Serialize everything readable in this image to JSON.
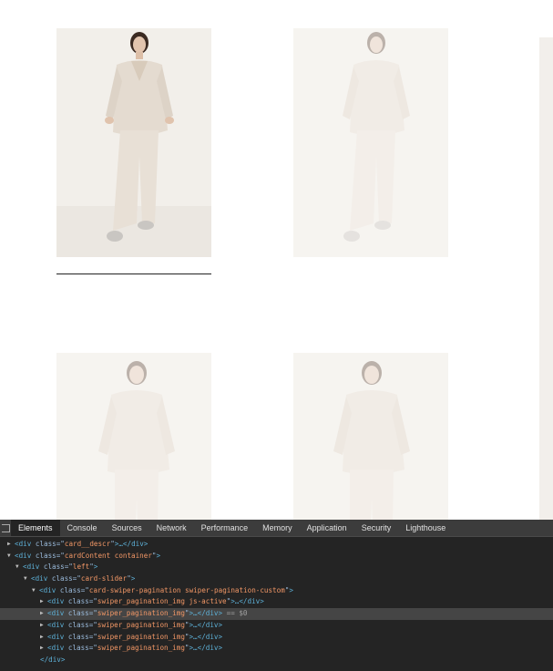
{
  "page": {
    "thumbnails": [
      {
        "name": "thumbnail-1",
        "state": "active"
      },
      {
        "name": "thumbnail-2",
        "state": "faded"
      },
      {
        "name": "thumbnail-3",
        "state": "faded"
      },
      {
        "name": "thumbnail-4",
        "state": "faded"
      }
    ]
  },
  "devtools": {
    "tabs": [
      "Elements",
      "Console",
      "Sources",
      "Network",
      "Performance",
      "Memory",
      "Application",
      "Security",
      "Lighthouse"
    ],
    "active_tab": "Elements",
    "rows": [
      {
        "tag": "div",
        "attr": "class",
        "val": "card__descr",
        "tail": ">…</",
        "close": "div",
        "selected": false
      },
      {
        "tag": "div",
        "attr": "class",
        "val": "cardContent container",
        "tail": ">",
        "selected": false
      },
      {
        "tag": "div",
        "attr": "class",
        "val": "left",
        "tail": ">",
        "selected": false
      },
      {
        "tag": "div",
        "attr": "class",
        "val": "card-slider",
        "tail": ">",
        "selected": false
      },
      {
        "tag": "div",
        "attr": "class",
        "val": "card-swiper-pagination swiper-pagination-custom",
        "tail": ">",
        "selected": false
      },
      {
        "tag": "div",
        "attr": "class",
        "val": "swiper_pagination_img js-active",
        "tail": ">…</",
        "close": "div",
        "selected": false
      },
      {
        "tag": "div",
        "attr": "class",
        "val": "swiper_pagination_img",
        "tail": ">…</",
        "close": "div",
        "ref": " == $0",
        "selected": true
      },
      {
        "tag": "div",
        "attr": "class",
        "val": "swiper_pagination_img",
        "tail": ">…</",
        "close": "div",
        "selected": false
      },
      {
        "tag": "div",
        "attr": "class",
        "val": "swiper_pagination_img",
        "tail": ">…</",
        "close": "div",
        "selected": false
      },
      {
        "tag": "div",
        "attr": "class",
        "val": "swiper_pagination_img",
        "tail": ">…</",
        "close": "div",
        "selected": false
      },
      {
        "closing": "div"
      }
    ]
  },
  "colors": {
    "devtools_bg": "#242424",
    "tabbar_bg": "#3c3c3c",
    "tag": "#5db0d7",
    "attr_value": "#f29766"
  }
}
